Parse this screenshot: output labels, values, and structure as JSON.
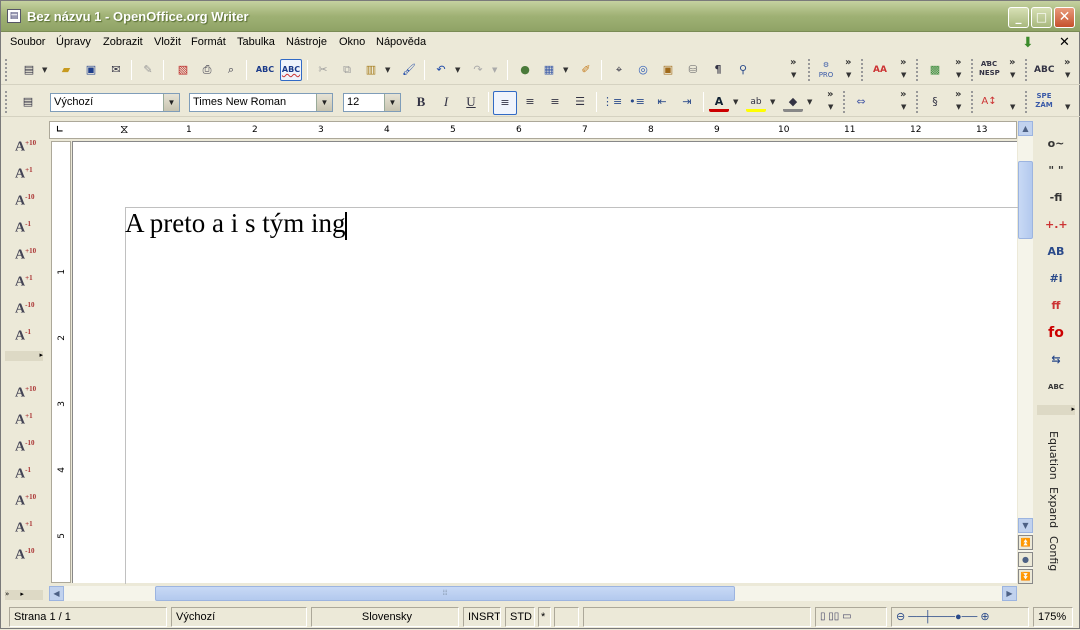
{
  "window": {
    "title": "Bez názvu 1 - OpenOffice.org Writer",
    "app_icon": "writer-doc-icon",
    "controls": {
      "minimize": "_",
      "maximize": "□",
      "close": "✕"
    }
  },
  "menubar": {
    "items": [
      "Soubor",
      "Úpravy",
      "Zobrazit",
      "Vložit",
      "Formát",
      "Tabulka",
      "Nástroje",
      "Okno",
      "Nápověda"
    ],
    "close_doc_glyph": "✕"
  },
  "formatting": {
    "paragraph_style": "Výchozí",
    "font_name": "Times New Roman",
    "font_size": "12",
    "bold": "B",
    "italic": "I",
    "underline": "U"
  },
  "toolbar_labels": {
    "spell_auto": "ABC",
    "spell_check": "ABC",
    "pro_label": "PRO",
    "aa_label": "AA",
    "nesp": "NESP",
    "spe_zam": "SPE ZÁM",
    "more": "»"
  },
  "ruler": {
    "h_ticks": [
      "1",
      "2",
      "3",
      "4",
      "5",
      "6",
      "7",
      "8",
      "9",
      "10",
      "11",
      "12",
      "13"
    ],
    "v_ticks": [
      "1",
      "2",
      "3",
      "4",
      "5"
    ]
  },
  "document": {
    "text": "A preto a i s tým ing"
  },
  "left_panel": {
    "icons": [
      "+10",
      "+1",
      "-10",
      "-1",
      "+10",
      "+1",
      "-10",
      "-1"
    ],
    "icons2": [
      "+10",
      "+1",
      "-10",
      "-1",
      "+10",
      "+1",
      "-10"
    ]
  },
  "right_panel": {
    "labels": [
      "Equation",
      "Expand",
      "Config"
    ],
    "glyphs": [
      "o~",
      "\" \"",
      "-fi",
      "+.+",
      "AB",
      "#i",
      "ff",
      "fo",
      "⇆",
      "ABC"
    ]
  },
  "statusbar": {
    "page": "Strana 1 / 1",
    "style": "Výchozí",
    "language": "Slovensky",
    "insert_mode": "INSRT",
    "selection_mode": "STD",
    "modified": "*",
    "zoom": "175%"
  },
  "colors": {
    "titlebar": "#9FB174",
    "chrome": "#ECE9D8",
    "scroll": "#C1D2EE"
  }
}
